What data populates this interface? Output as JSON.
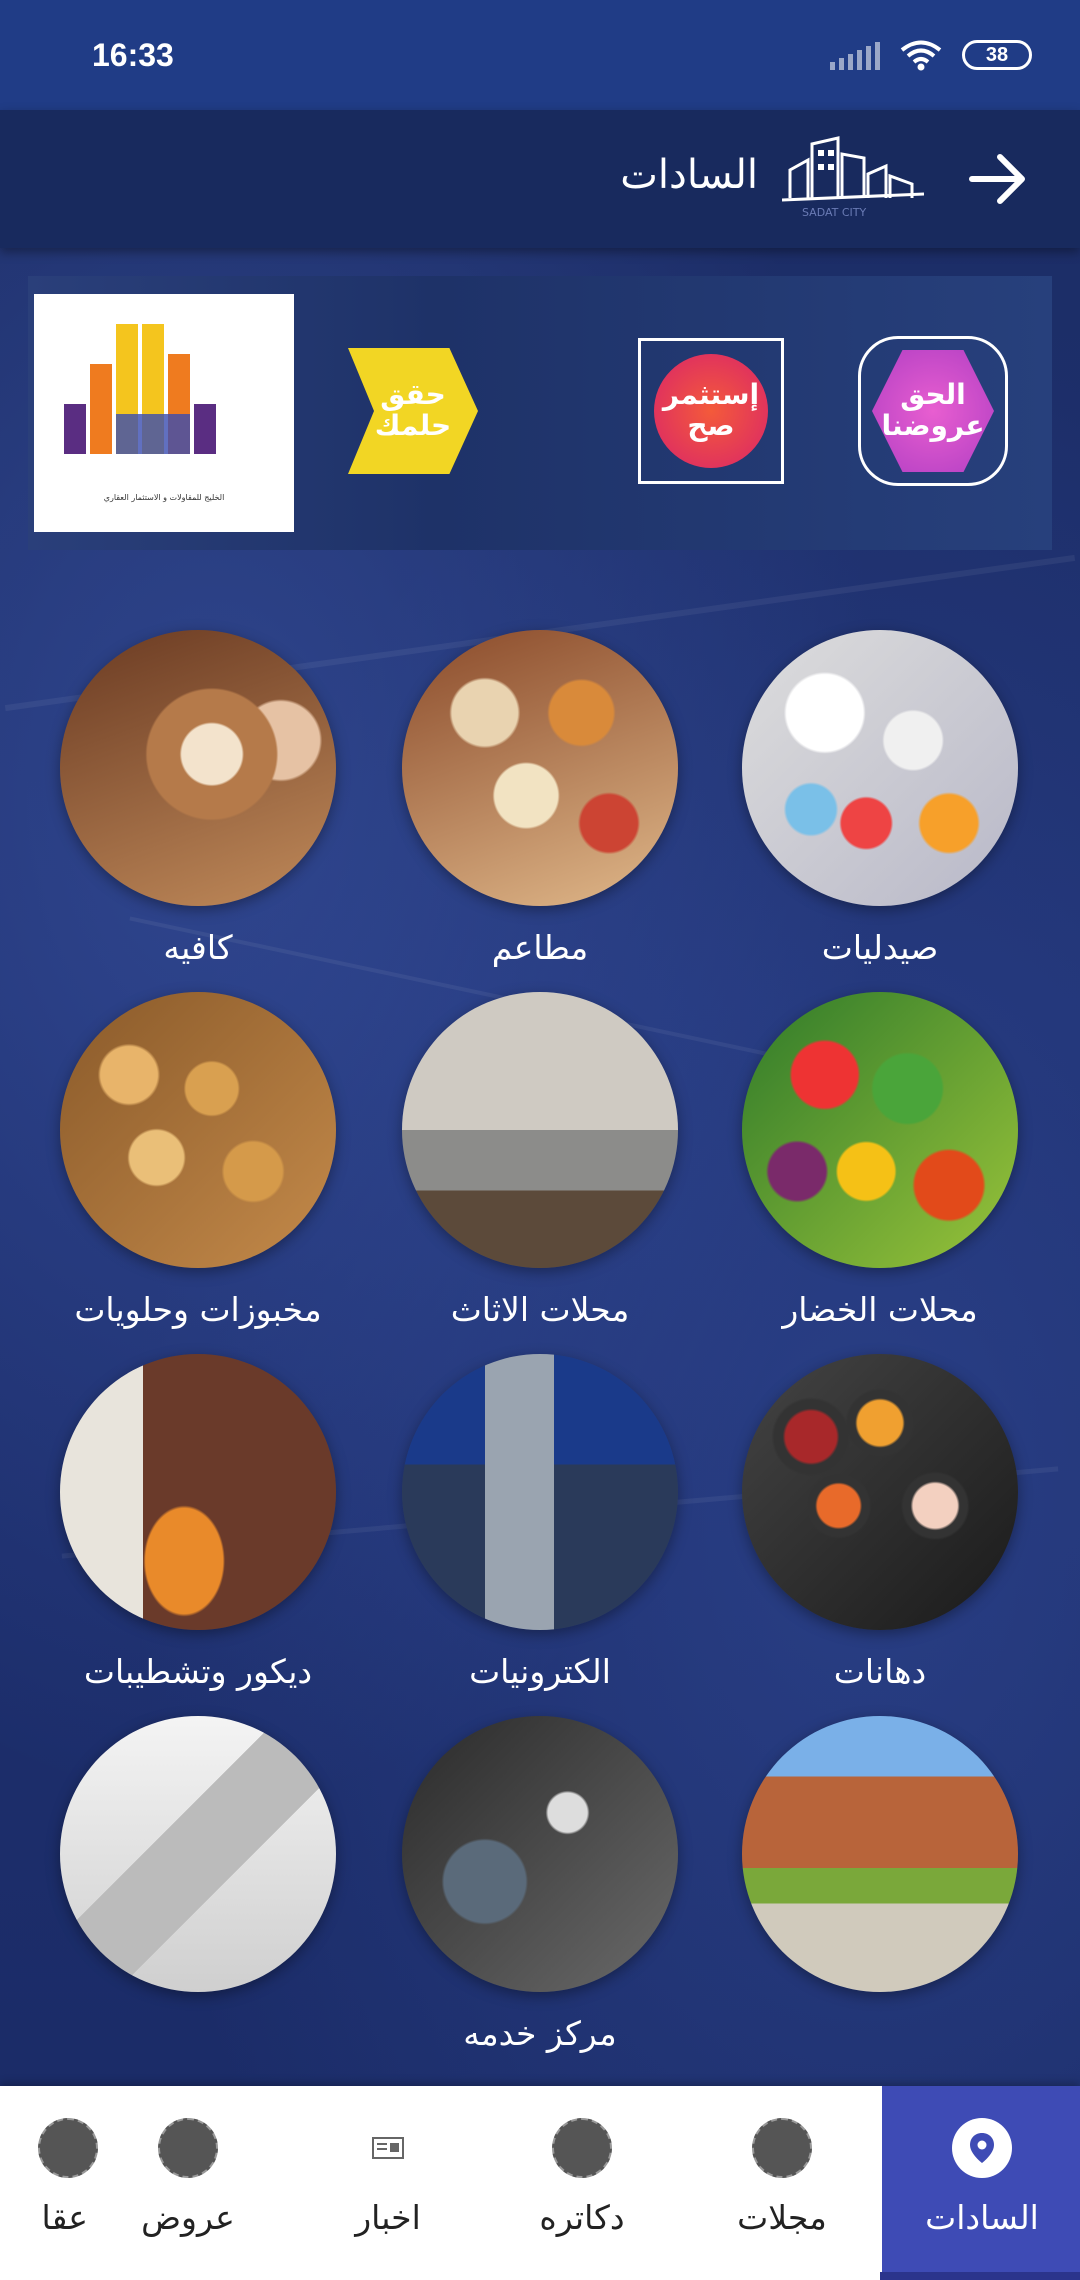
{
  "status_bar": {
    "time": "16:33",
    "battery": "38"
  },
  "header": {
    "title": "السادات",
    "logo_caption": "SADAT CITY"
  },
  "banner": {
    "logo_caption": "الخليج للمقاولات و الاستثمار العقاري",
    "items": [
      {
        "label": "حقق حلمك"
      },
      {
        "label": "إستثمر صح"
      },
      {
        "label": "الحق عروضنا"
      }
    ]
  },
  "categories": [
    {
      "label": "صيدليات",
      "icon": "pharmacy"
    },
    {
      "label": "مطاعم",
      "icon": "restaurant"
    },
    {
      "label": "كافيه",
      "icon": "cafe"
    },
    {
      "label": "محلات الخضار",
      "icon": "vegetables"
    },
    {
      "label": "محلات الاثاث",
      "icon": "furniture"
    },
    {
      "label": "مخبوزات وحلويات",
      "icon": "bakery"
    },
    {
      "label": "دهانات",
      "icon": "paints"
    },
    {
      "label": "الكترونيات",
      "icon": "electronics"
    },
    {
      "label": "ديكور وتشطيبات",
      "icon": "decor"
    },
    {
      "label": "",
      "icon": "school"
    },
    {
      "label": "مركز خدمه",
      "icon": "service-center"
    },
    {
      "label": "",
      "icon": "construction"
    }
  ],
  "bottom_nav": {
    "items": [
      {
        "label": "السادات",
        "icon": "location-pin-icon",
        "active": true
      },
      {
        "label": "مجلات",
        "icon": "magazine-icon",
        "active": false
      },
      {
        "label": "دكاتره",
        "icon": "doctor-icon",
        "active": false
      },
      {
        "label": "اخبار",
        "icon": "news-icon",
        "active": false
      },
      {
        "label": "عروض",
        "icon": "calendar-icon",
        "active": false
      },
      {
        "label": "عقا",
        "icon": "realestate-icon",
        "active": false
      }
    ]
  },
  "colors": {
    "status_bar": "#203c86",
    "header": "#182a5e",
    "background": "#1a2a62",
    "nav_active": "#3e4bb5"
  }
}
